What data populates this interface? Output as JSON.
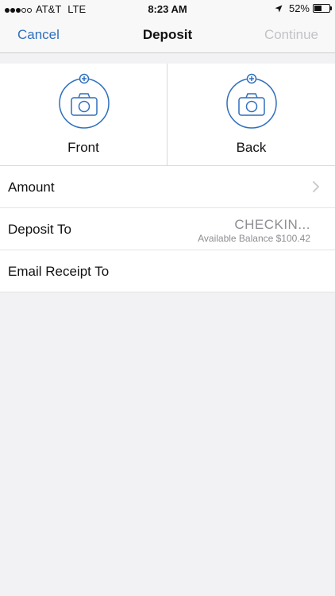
{
  "status_bar": {
    "signal_bars": [
      true,
      true,
      true,
      false,
      false
    ],
    "carrier": "AT&T",
    "network": "LTE",
    "time": "8:23 AM",
    "battery_percent_text": "52%",
    "battery_level": 0.52
  },
  "nav": {
    "cancel_label": "Cancel",
    "title": "Deposit",
    "continue_label": "Continue"
  },
  "capture": {
    "front_label": "Front",
    "back_label": "Back"
  },
  "form": {
    "amount_label": "Amount",
    "deposit_to_label": "Deposit To",
    "deposit_to_value": "CHECKIN...",
    "deposit_to_balance": "Available Balance $100.42",
    "email_receipt_label": "Email Receipt To"
  },
  "colors": {
    "accent": "#2f6fbd",
    "disabled": "#c3c3c7",
    "secondary_text": "#8e8e93",
    "background": "#f2f2f4"
  }
}
